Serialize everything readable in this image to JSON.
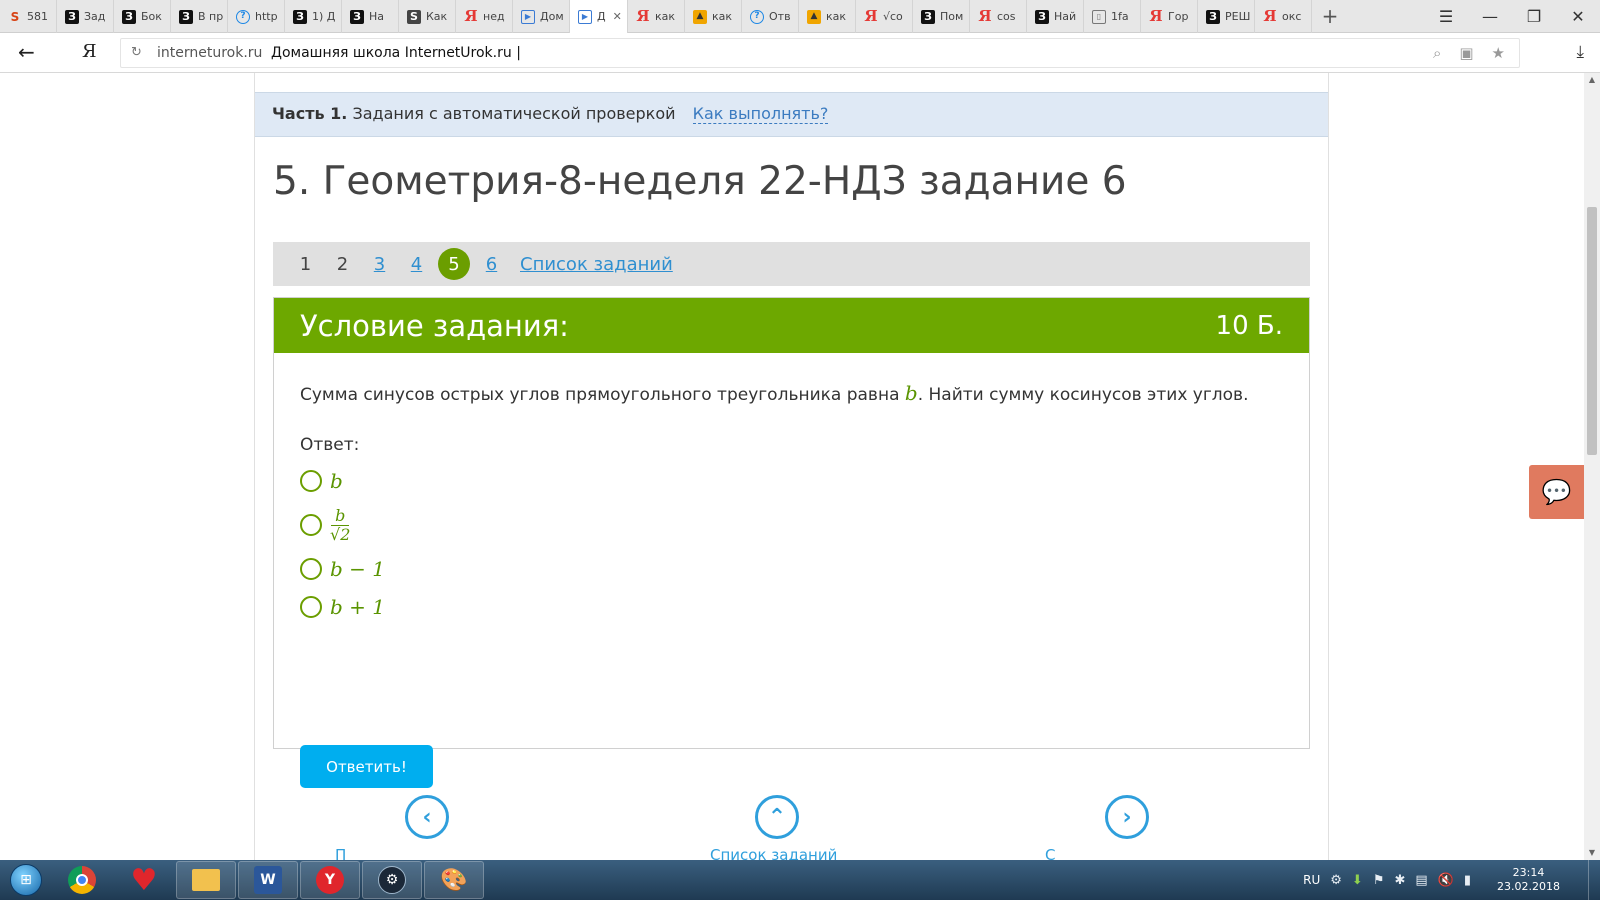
{
  "browser": {
    "tabs": [
      {
        "icon": "fire-icon",
        "glyph": "S",
        "cls": "yd",
        "label": "581"
      },
      {
        "icon": "z-site-icon",
        "glyph": "З",
        "cls": "z",
        "label": "Зад"
      },
      {
        "icon": "z-site-icon",
        "glyph": "З",
        "cls": "z",
        "label": "Бок"
      },
      {
        "icon": "z-site-icon",
        "glyph": "З",
        "cls": "z",
        "label": "В пр"
      },
      {
        "icon": "question-icon",
        "glyph": "?",
        "cls": "q",
        "label": "http"
      },
      {
        "icon": "z-site-icon",
        "glyph": "З",
        "cls": "z",
        "label": "1) Д"
      },
      {
        "icon": "z-site-icon",
        "glyph": "З",
        "cls": "z",
        "label": "На"
      },
      {
        "icon": "s-site-icon",
        "glyph": "S",
        "cls": "s",
        "label": "Как"
      },
      {
        "icon": "yandex-icon",
        "glyph": "Я",
        "cls": "ya",
        "label": "нед"
      },
      {
        "icon": "play-icon",
        "glyph": "▶",
        "cls": "play",
        "label": "Дом"
      },
      {
        "icon": "play-icon",
        "glyph": "▶",
        "cls": "play",
        "label": "Д",
        "active": true
      },
      {
        "icon": "yandex-icon",
        "glyph": "Я",
        "cls": "ya",
        "label": "как"
      },
      {
        "icon": "image-icon",
        "glyph": "▲",
        "cls": "img",
        "label": "как"
      },
      {
        "icon": "question-icon",
        "glyph": "?",
        "cls": "q",
        "label": "Отв"
      },
      {
        "icon": "image-icon",
        "glyph": "▲",
        "cls": "img",
        "label": "как"
      },
      {
        "icon": "yandex-icon",
        "glyph": "Я",
        "cls": "ya",
        "label": "√co"
      },
      {
        "icon": "z-site-icon",
        "glyph": "З",
        "cls": "z",
        "label": "Пом"
      },
      {
        "icon": "yandex-icon",
        "glyph": "Я",
        "cls": "ya",
        "label": "cos"
      },
      {
        "icon": "z-site-icon",
        "glyph": "З",
        "cls": "z",
        "label": "Най"
      },
      {
        "icon": "document-icon",
        "glyph": "▯",
        "cls": "doc",
        "label": "1fa"
      },
      {
        "icon": "yandex-icon",
        "glyph": "Я",
        "cls": "ya",
        "label": "Гор"
      },
      {
        "icon": "z-site-icon",
        "glyph": "З",
        "cls": "z",
        "label": "РЕШ"
      },
      {
        "icon": "yandex-icon",
        "glyph": "Я",
        "cls": "ya",
        "label": "окс"
      }
    ],
    "new_tab": "+",
    "url_host": "interneturok.ru",
    "url_title": "Домашняя школа InternetUrok.ru |",
    "logo": "Я"
  },
  "page": {
    "part_label": "Часть 1.",
    "part_text": "Задания с автоматической проверкой",
    "how_link": "Как выполнять?",
    "task_title": "5. Геометрия-8-неделя 22-НДЗ задание 6",
    "pager": [
      {
        "label": "1",
        "state": "done"
      },
      {
        "label": "2",
        "state": "done"
      },
      {
        "label": "3",
        "state": "link"
      },
      {
        "label": "4",
        "state": "link"
      },
      {
        "label": "5",
        "state": "current"
      },
      {
        "label": "6",
        "state": "link"
      }
    ],
    "task_list_link": "Список заданий",
    "condition_title": "Условие задания:",
    "points": "10 Б.",
    "question_before": "Сумма синусов острых углов прямоугольного треугольника равна ",
    "question_var": "b",
    "question_after": ". Найти сумму косинусов этих углов.",
    "answer_label": "Ответ:",
    "options": {
      "opt1": "b",
      "opt2_num": "b",
      "opt2_den": "√2",
      "opt3": "b − 1",
      "opt4": "b + 1"
    },
    "submit_label": "Ответить!",
    "nav": {
      "prev": "П",
      "list": "Список заданий",
      "next": "С"
    }
  },
  "taskbar": {
    "lang": "RU",
    "time": "23:14",
    "date": "23.02.2018"
  },
  "colors": {
    "accent_green": "#6da800",
    "link_blue": "#2f8fd0",
    "submit_blue": "#00aeef",
    "chat_orange": "#e07a5f"
  }
}
